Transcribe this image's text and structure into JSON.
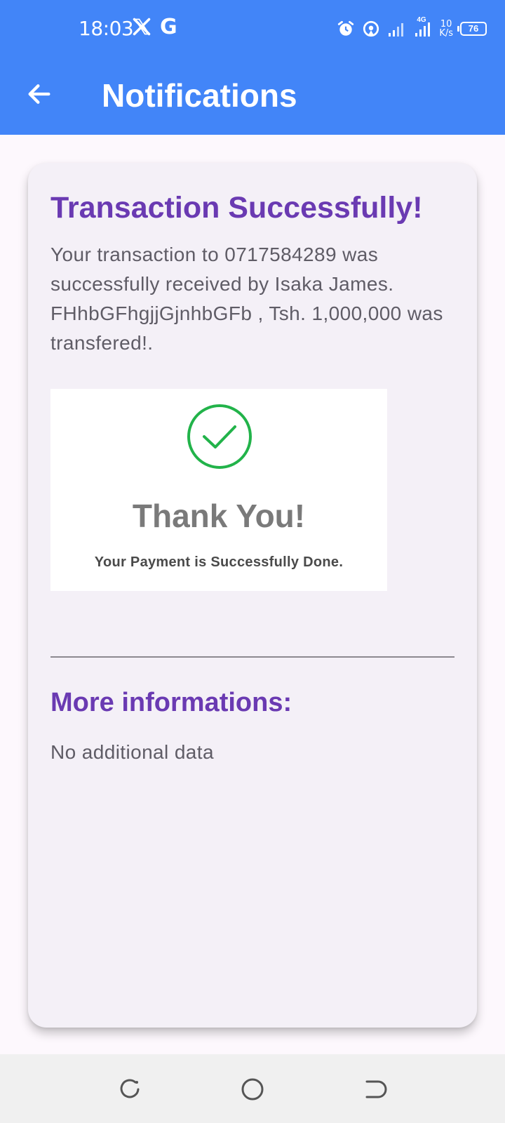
{
  "status_bar": {
    "time": "18:03",
    "left_icons": [
      "x-logo-icon",
      "google-g-icon"
    ],
    "right_icons": [
      "alarm-icon",
      "hotspot-icon",
      "signal-icon",
      "signal-4g-icon"
    ],
    "network_type": "4G",
    "net_speed_value": "10",
    "net_speed_unit": "K/s",
    "battery": "76",
    "g_letter": "G"
  },
  "app_bar": {
    "title": "Notifications",
    "back_icon": "arrow-left-icon",
    "color": "#4285f8"
  },
  "notification": {
    "title": "Transaction Successfully!",
    "message": "Your transaction to 0717584289 was successfully received by Isaka James. FHhbGFhgjjGjnhbGFb , Tsh. 1,000,000 was transfered!.",
    "image": {
      "check_icon": "check-circle-icon",
      "title": "Thank You!",
      "subtitle": "Your Payment is Successfully Done."
    },
    "more_title": "More informations:",
    "more_body": "No additional data",
    "accent_color": "#6a3ab2"
  },
  "nav_bar": {
    "recent_icon": "recent-apps-icon",
    "home_icon": "home-circle-icon",
    "back_icon": "back-icon"
  }
}
